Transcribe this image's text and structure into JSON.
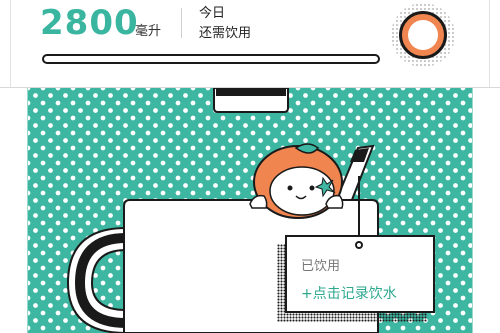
{
  "header": {
    "amount": "2800",
    "unit": "毫升",
    "today_label": "今日",
    "need_label": "还需饮用"
  },
  "card": {
    "title": "已饮用",
    "action": "+点击记录饮水"
  },
  "colors": {
    "accent": "#3ab5a0",
    "scene_background": "#3db7a2",
    "ring_fill": "#f08550",
    "character_orange": "#f08550"
  },
  "icons": {
    "ring_button": "orange-ring-icon",
    "mascot": "orange-mascot-icon",
    "straw": "straw-icon",
    "cup": "cup-icon"
  }
}
